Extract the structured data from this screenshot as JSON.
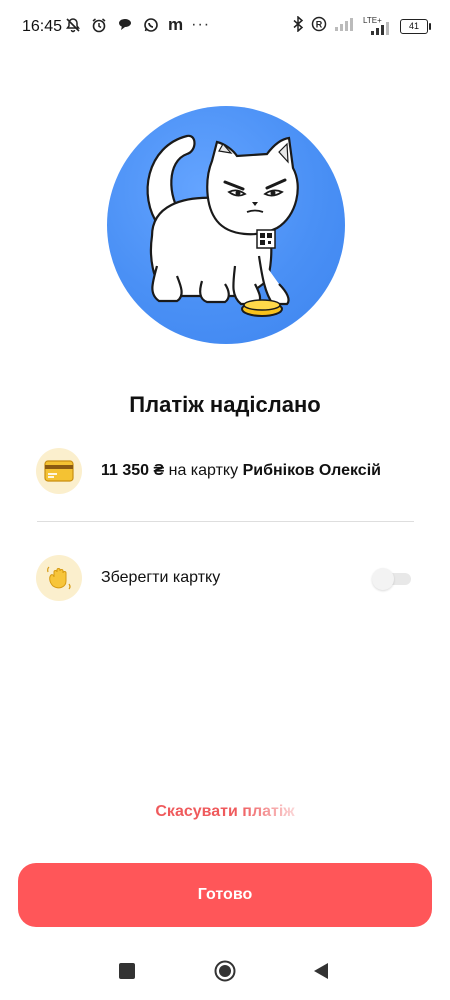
{
  "status_bar": {
    "time": "16:45",
    "app_letter": "m",
    "more": "···",
    "network_label": "LTE+",
    "battery": "41"
  },
  "content": {
    "title": "Платіж надіслано",
    "payment": {
      "amount": "11 350 ₴",
      "middle": "на картку",
      "recipient": "Рибніков Олексій"
    },
    "save_card": {
      "label": "Зберегти картку",
      "enabled": false
    }
  },
  "actions": {
    "cancel_label": "Скасувати платіж",
    "done_label": "Готово"
  },
  "colors": {
    "accent": "#ff5659",
    "hero_blue": "#4a90f5",
    "icon_bg": "#fbefcd"
  },
  "icons": [
    "muted-bell-icon",
    "alarm-icon",
    "chat-icon",
    "whatsapp-icon",
    "bluetooth-icon",
    "registered-icon",
    "signal-icon",
    "battery-icon",
    "credit-card-icon",
    "waving-hand-icon",
    "square-nav-icon",
    "home-nav-icon",
    "back-nav-icon"
  ]
}
